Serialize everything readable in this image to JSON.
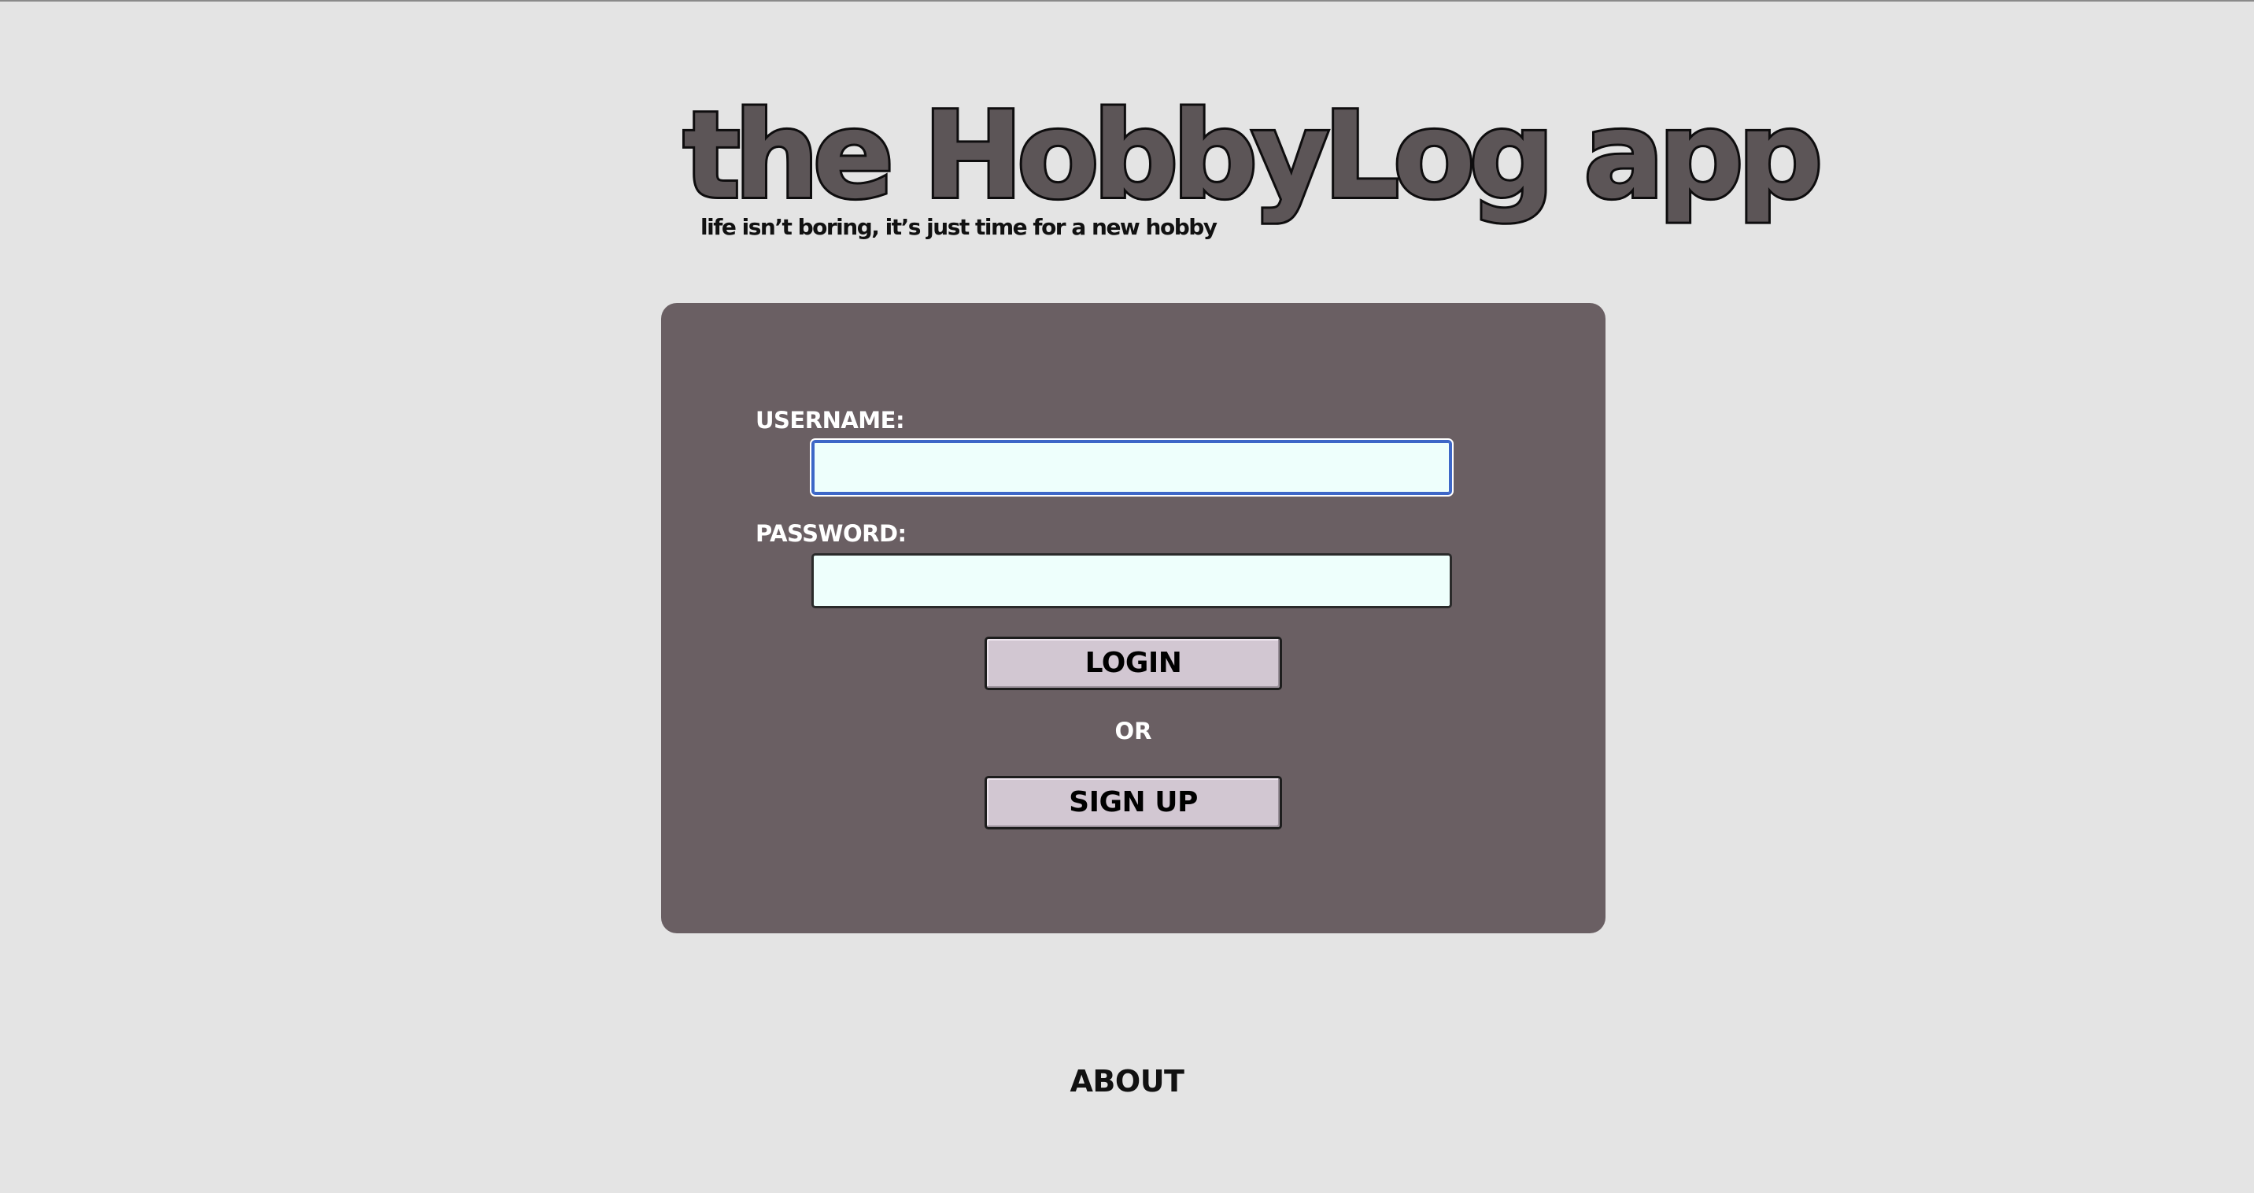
{
  "header": {
    "title": "the HobbyLog app",
    "tagline": "life isn’t boring, it’s just time for a new hobby"
  },
  "login_form": {
    "username_label": "USERNAME:",
    "username_value": "",
    "password_label": "PASSWORD:",
    "password_value": "",
    "login_label": "LOGIN",
    "or_text": "OR",
    "signup_label": "SIGN UP"
  },
  "footer": {
    "about_label": "ABOUT"
  },
  "colors": {
    "page_background": "#e4e4e4",
    "panel_background": "#6a5f63",
    "title_fill": "#5c5557",
    "input_background": "#eefffc",
    "button_background": "#d2c7d2",
    "focus_ring": "#3d67c7"
  }
}
